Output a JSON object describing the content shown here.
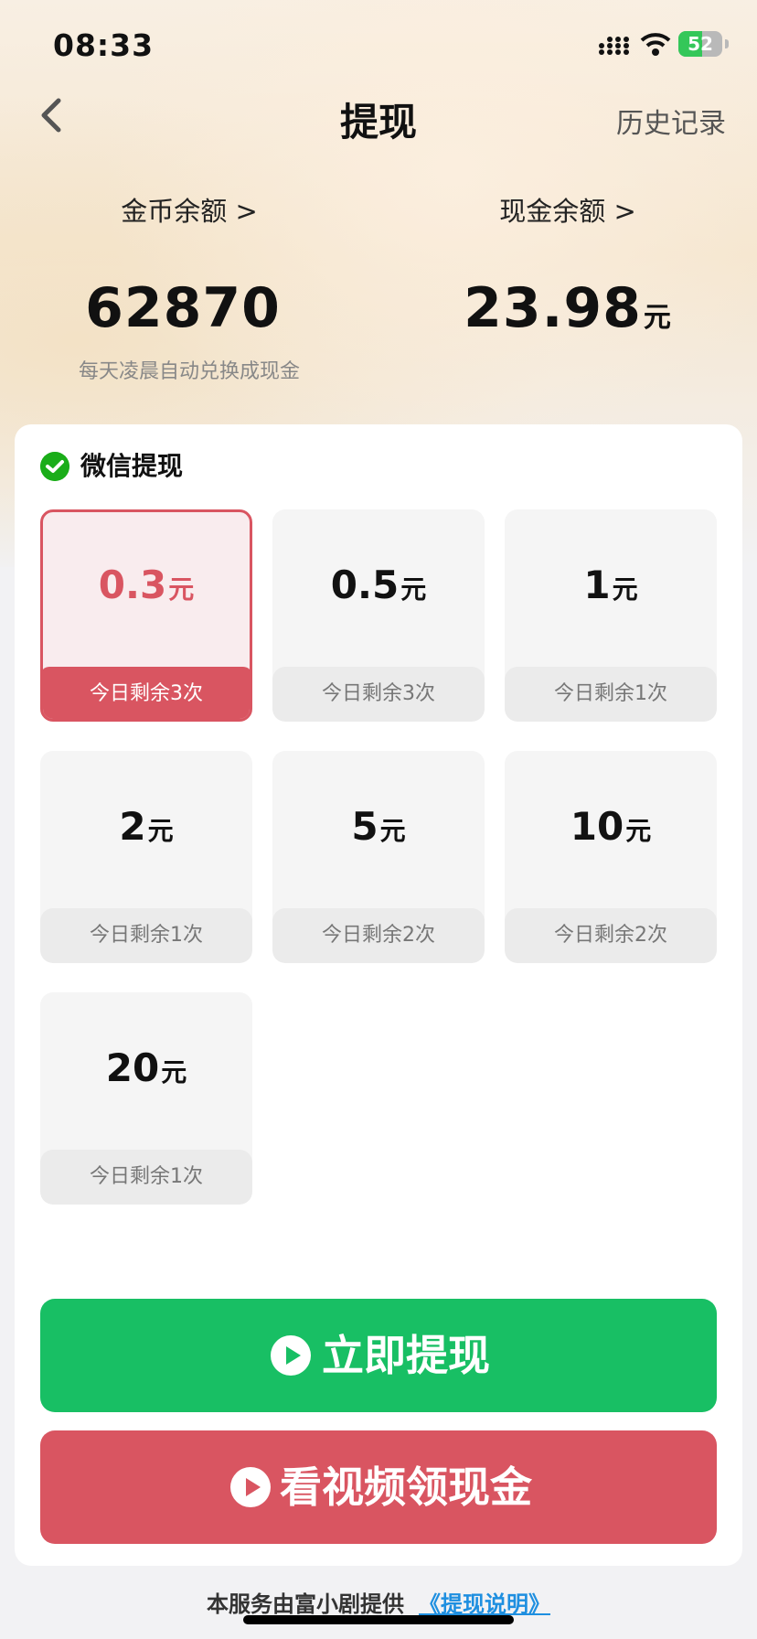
{
  "status": {
    "time": "08:33",
    "battery": "52"
  },
  "nav": {
    "title": "提现",
    "history": "历史记录"
  },
  "balances": {
    "coin_label": "金币余额 >",
    "coin_value": "62870",
    "coin_note": "每天凌晨自动兑换成现金",
    "cash_label": "现金余额 >",
    "cash_value": "23.98",
    "cash_unit": "元"
  },
  "wechat": {
    "title": "微信提现"
  },
  "options": [
    {
      "amount": "0.3",
      "unit": "元",
      "remain": "今日剩余3次",
      "selected": true
    },
    {
      "amount": "0.5",
      "unit": "元",
      "remain": "今日剩余3次"
    },
    {
      "amount": "1",
      "unit": "元",
      "remain": "今日剩余1次"
    },
    {
      "amount": "2",
      "unit": "元",
      "remain": "今日剩余1次"
    },
    {
      "amount": "5",
      "unit": "元",
      "remain": "今日剩余2次"
    },
    {
      "amount": "10",
      "unit": "元",
      "remain": "今日剩余2次"
    },
    {
      "amount": "20",
      "unit": "元",
      "remain": "今日剩余1次"
    }
  ],
  "buttons": {
    "withdraw": "立即提现",
    "video": "看视频领现金"
  },
  "footer": {
    "text": "本服务由富小剧提供",
    "link": "《提现说明》"
  },
  "colors": {
    "accent_red": "#d95561",
    "accent_green": "#18bf64",
    "link_blue": "#1e8fe0"
  }
}
